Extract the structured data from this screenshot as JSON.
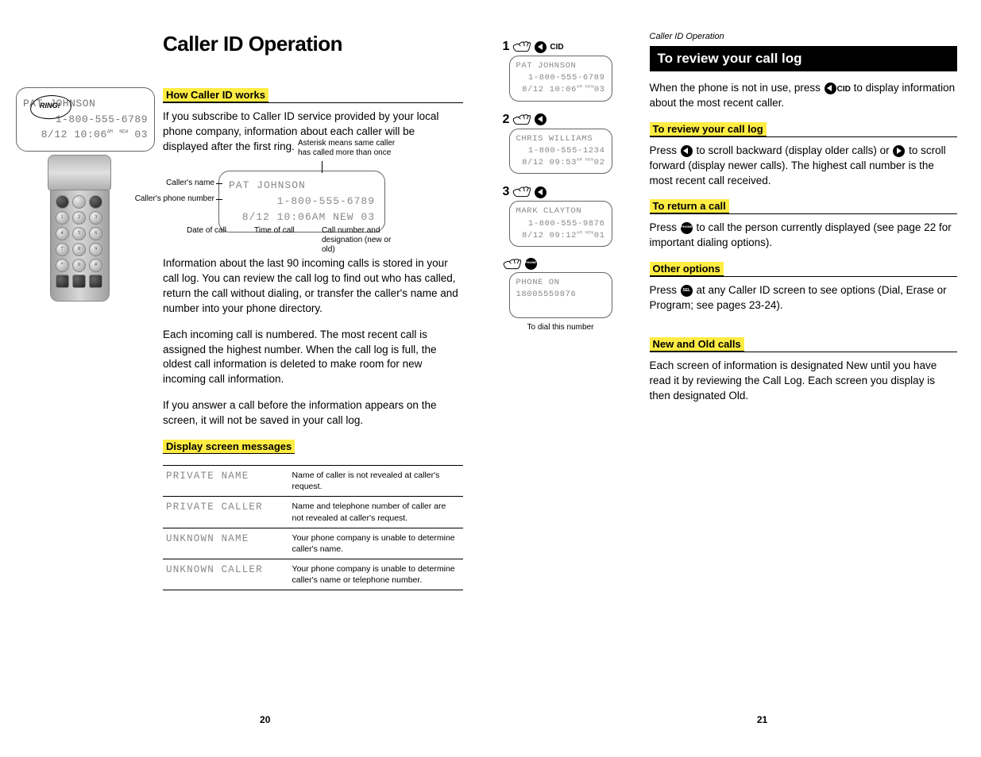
{
  "left": {
    "ring": "RING!",
    "phoneDisplay": {
      "name": "PAT JOHNSON",
      "number": "1-800-555-6789",
      "dateLine": "8/12 10:06",
      "ampm": "AM",
      "newTag": "NEW",
      "callNum": "03"
    },
    "title": "Caller ID Operation",
    "howHead": "How Caller ID works",
    "p1": "If you subscribe to Caller ID service provided by your local phone company, information about each caller will be displayed after the first ring.",
    "diagram": {
      "name": "PAT JOHNSON",
      "number": "1-800-555-6789",
      "dateLine": "8/12 10:06",
      "ampm": "AM",
      "newTag": "NEW",
      "callNum": "03",
      "annoTop": "Asterisk means same caller has called more than once",
      "annoName": "Caller's name",
      "annoPhone": "Caller's phone number",
      "annoDate": "Date of call",
      "annoTime": "Time of call",
      "annoCallNum": "Call number and designation (new or old)"
    },
    "p2": "Information about the last 90 incoming calls is stored in your call log. You can review the call log to find out who has called, return the call without dialing, or transfer the caller's name and number into your phone directory.",
    "p3": "Each incoming call is numbered. The most recent call is assigned the highest number. When the call log is full, the oldest call information is deleted to make room for new incoming call information.",
    "p4": "If you answer a call before the information appears on the screen, it will not be saved in your call log.",
    "msgsHead": "Display screen messages",
    "msgs": [
      {
        "code": "PRIVATE NAME",
        "desc": "Name of caller is not revealed at caller's request."
      },
      {
        "code": "PRIVATE CALLER",
        "desc": "Name and telephone number of caller are not revealed at caller's request."
      },
      {
        "code": "UNKNOWN NAME",
        "desc": "Your phone company is unable to determine caller's name."
      },
      {
        "code": "UNKNOWN CALLER",
        "desc": "Your phone company is unable to determine caller's name or telephone number."
      }
    ],
    "pageNum": "20"
  },
  "right": {
    "steps": [
      {
        "n": "1",
        "cid": "CID",
        "lcd": {
          "name": "PAT JOHNSON",
          "number": "1-800-555-6789",
          "date": "8/12 10:06",
          "sup": "AM NEW",
          "cn": "03"
        }
      },
      {
        "n": "2",
        "lcd": {
          "name": "CHRIS WILLIAMS",
          "number": "1-800-555-1234",
          "date": "8/12 09:53",
          "sup": "AM NEW",
          "cn": "02"
        }
      },
      {
        "n": "3",
        "lcd": {
          "name": "MARK CLAYTON",
          "number": "1-800-555-9876",
          "date": "8/12 09:12",
          "sup": "AM NEW",
          "cn": "01"
        }
      }
    ],
    "dialLcd": {
      "l1": "PHONE ON",
      "l2": "18005559876"
    },
    "dialCaption": "To dial this number",
    "runningHead": "Caller ID Operation",
    "revTitle": "To review your call log",
    "intro1": "When the phone is not in use, press ",
    "intro2": " to display information about the most recent caller.",
    "cidLabel": "CID",
    "h1": "To review your call log",
    "p1a": "Press ",
    "p1b": " to scroll backward (display older calls) or ",
    "p1c": " to scroll forward (display newer calls). The highest call number is the most recent call received.",
    "h2": "To return a call",
    "p2a": "Press ",
    "p2b": " to call the person currently displayed (see page 22 for important dialing options).",
    "h3": "Other options",
    "p3a": "Press ",
    "p3b": " at any Caller ID screen to see options (Dial, Erase or Program; see pages 23-24).",
    "h4": "New and Old calls",
    "p4": "Each screen of information is designated New until you have read it by reviewing the Call Log. Each screen you display is then designated Old.",
    "pageNum": "21"
  }
}
